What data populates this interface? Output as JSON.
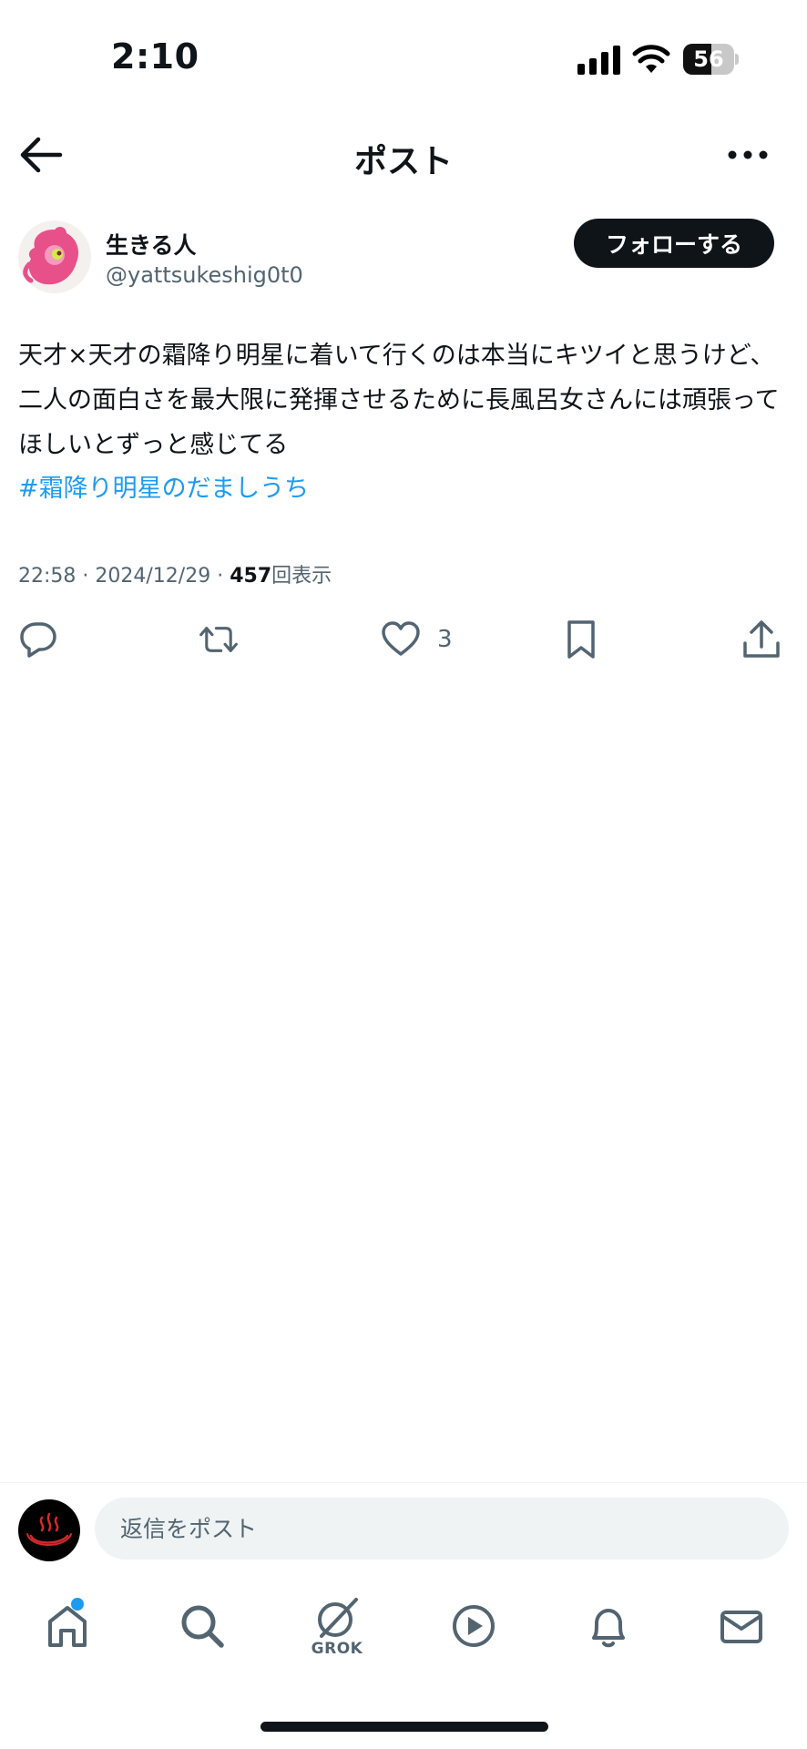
{
  "status_bar": {
    "time": "2:10",
    "battery_text": "56",
    "battery_level": 0.56
  },
  "header": {
    "title": "ポスト"
  },
  "post": {
    "author": {
      "display_name": "生きる人",
      "handle": "@yattsukeshig0t0"
    },
    "follow_label": "フォローする",
    "text": "天才×天才の霜降り明星に着いて行くのは本当にキツイと思うけど、二人の面白さを最大限に発揮させるために長風呂女さんには頑張ってほしいとずっと感じてる",
    "hashtag": "#霜降り明星のだましうち",
    "time": "22:58",
    "date": "2024/12/29",
    "views_count": "457",
    "views_label": "回表示",
    "separator": "·",
    "like_count": "3"
  },
  "reply": {
    "placeholder": "返信をポスト"
  },
  "tabbar": {
    "grok_label": "GROK"
  },
  "colors": {
    "accent": "#1d9bf0",
    "text_primary": "#0f1419",
    "text_secondary": "#536471"
  }
}
